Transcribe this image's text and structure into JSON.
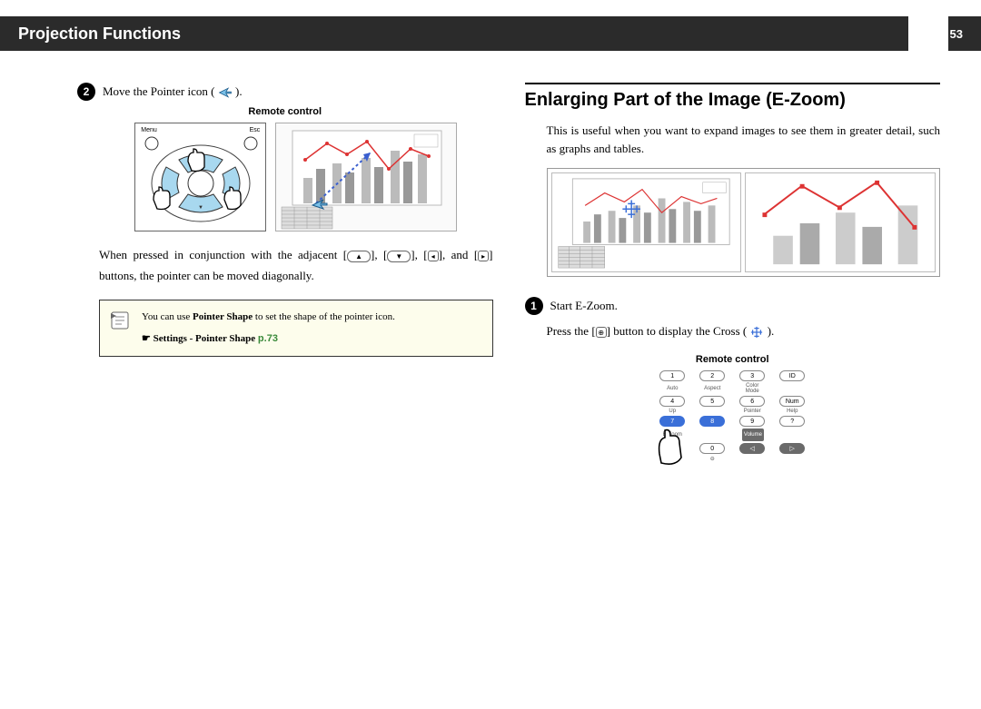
{
  "header": {
    "title": "Projection Functions",
    "page": "53"
  },
  "left": {
    "step_num": "2",
    "step_text": "Move  the  Pointer  icon  (",
    "step_text_after": ").",
    "caption": "Remote control",
    "remote_labels": {
      "menu": "Menu",
      "esc": "Esc"
    },
    "para_a": "When  pressed  in  conjunction  with  the  adjacent  [",
    "para_b": "],  [",
    "para_c": "],  [",
    "para_d": "],  and  [",
    "para_e": "]  buttons,  the  pointer  can  be  moved  diagonally.",
    "tip_a": "You  can  use  ",
    "tip_bold": "Pointer Shape",
    "tip_b": "  to  set  the  shape  of  the  pointer icon.",
    "tip_link_prefix": "☛  Settings  -  Pointer  Shape  ",
    "tip_link_page": "p.73"
  },
  "right": {
    "heading": "Enlarging  Part  of  the  Image  (E-Zoom)",
    "intro": "This  is  useful  when  you  want  to  expand  images  to  see  them  in  greater detail,  such  as  graphs  and  tables.",
    "step_num": "1",
    "step_text": "Start  E-Zoom.",
    "press_a": "Press  the  [",
    "press_b": "]  button  to  display  the  Cross  (",
    "press_c": ").",
    "caption": "Remote control",
    "remote": {
      "r1": [
        "1",
        "2",
        "3",
        "ID"
      ],
      "l1": [
        "Auto",
        "Aspect",
        "Color Mode",
        ""
      ],
      "r2": [
        "4",
        "5",
        "6",
        "Num"
      ],
      "l2": [
        "Up",
        "",
        "Pointer",
        "Help"
      ],
      "r3": [
        "7",
        "8",
        "9",
        "?"
      ],
      "l3": [
        "E-Zoom",
        "",
        "Volume",
        ""
      ],
      "r4": [
        "",
        "0",
        "◁",
        "▷"
      ],
      "l4": [
        "Down",
        "⊖",
        "",
        ""
      ]
    }
  }
}
